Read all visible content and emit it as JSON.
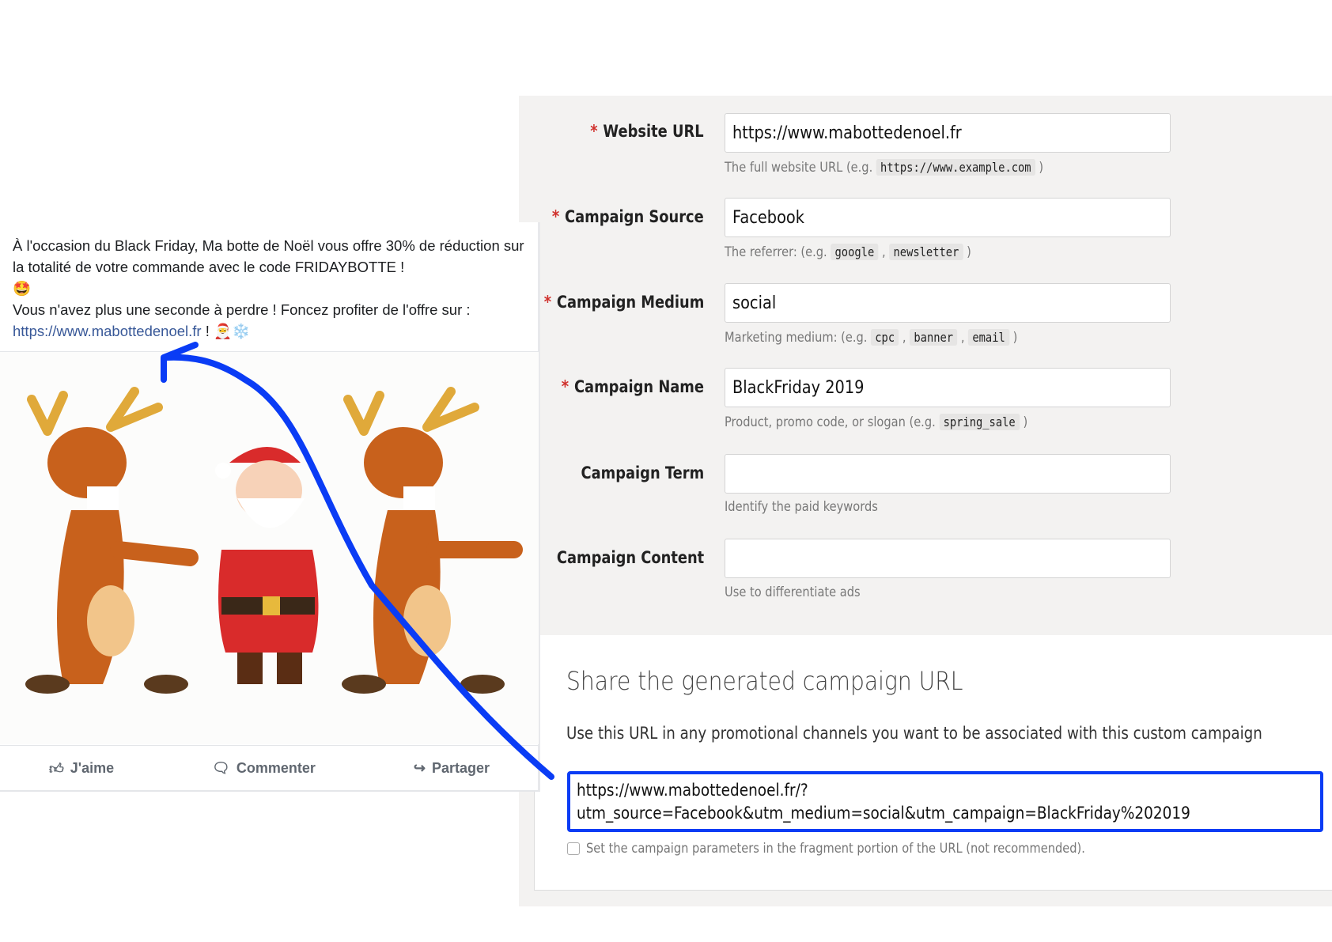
{
  "post": {
    "line1": "À l'occasion du Black Friday, Ma botte de Noël vous offre 30% de réduction sur la totalité de votre commande avec le code FRIDAYBOTTE !",
    "emoji1": "🤩",
    "line2": "Vous n'avez plus une seconde à perdre ! Foncez profiter de l'offre sur :",
    "link": "https://www.mabottedenoel.fr",
    "after_link": " ! 🎅❄️",
    "actions": [
      {
        "label": "J'aime",
        "icon": "thumbs-up-icon"
      },
      {
        "label": "Commenter",
        "icon": "comment-icon"
      },
      {
        "label": "Partager",
        "icon": "share-icon"
      }
    ]
  },
  "form": {
    "website_url": {
      "label": "Website URL",
      "required": "*",
      "value": "https://www.mabottedenoel.fr",
      "help": "The full website URL (e.g.",
      "codes": [
        "https://www.example.com"
      ]
    },
    "source": {
      "label": "Campaign Source",
      "required": "*",
      "value": "Facebook",
      "help": "The referrer: (e.g.",
      "codes": [
        "google",
        "newsletter"
      ]
    },
    "medium": {
      "label": "Campaign Medium",
      "required": "*",
      "value": "social",
      "help": "Marketing medium: (e.g.",
      "codes": [
        "cpc",
        "banner",
        "email"
      ]
    },
    "name": {
      "label": "Campaign Name",
      "required": "*",
      "value": "BlackFriday 2019",
      "help": "Product, promo code, or slogan (e.g.",
      "codes": [
        "spring_sale"
      ]
    },
    "term": {
      "label": "Campaign Term",
      "value": "",
      "help": "Identify the paid keywords"
    },
    "content": {
      "label": "Campaign Content",
      "value": "",
      "help": "Use to differentiate ads"
    }
  },
  "share": {
    "title": "Share the generated campaign URL",
    "description": "Use this URL in any promotional channels you want to be associated with this custom campaign",
    "url_line1": "https://www.mabottedenoel.fr/?",
    "url_line2": "utm_source=Facebook&utm_medium=social&utm_campaign=BlackFriday%202019",
    "checkbox_label": "Set the campaign parameters in the fragment portion of the URL (not recommended).",
    "checkbox_checked": false
  },
  "colors": {
    "highlight": "#0a3cf5",
    "required": "#d0312d",
    "link": "#385898",
    "panel": "#f3f2f1"
  }
}
